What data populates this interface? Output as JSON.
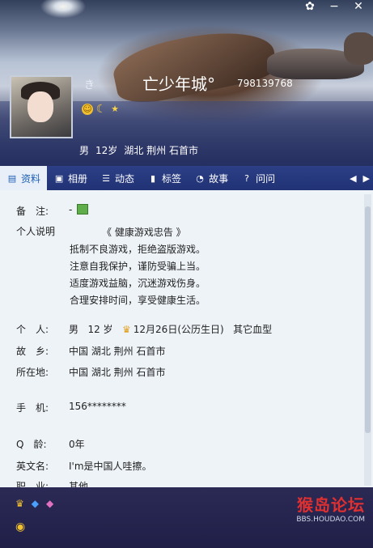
{
  "window": {
    "buttons": [
      "skin-icon",
      "minimize-icon",
      "close-icon"
    ],
    "minimize": "−",
    "close": "✕",
    "skin": "✿"
  },
  "profile": {
    "small_symbol": "き",
    "nickname": "亡少年城°",
    "qq": "798139768",
    "gender": "男",
    "age": "12岁",
    "province": "湖北",
    "city": "荆州",
    "district": "石首市"
  },
  "tabs": [
    {
      "label": "资料",
      "icon": "profile-icon"
    },
    {
      "label": "相册",
      "icon": "album-icon"
    },
    {
      "label": "动态",
      "icon": "feed-icon"
    },
    {
      "label": "标签",
      "icon": "tag-icon"
    },
    {
      "label": "故事",
      "icon": "story-icon"
    },
    {
      "label": "问问",
      "icon": "ask-icon"
    }
  ],
  "details": {
    "remark_label": "备　注:",
    "remark_value": "-",
    "intro_label": "个人说明",
    "intro_lines": [
      "《 健康游戏忠告 》",
      "抵制不良游戏，拒绝盗版游戏。",
      "注意自我保护，谨防受骗上当。",
      "适度游戏益脑，沉迷游戏伤身。",
      "合理安排时间，享受健康生活。"
    ],
    "personal_label": "个　人:",
    "personal_gender": "男",
    "personal_age": "12 岁",
    "personal_birthday": "12月26日(公历生日)",
    "personal_blood": "其它血型",
    "hometown_label": "故　乡:",
    "hometown_value": "中国 湖北 荆州 石首市",
    "location_label": "所在地:",
    "location_value": "中国 湖北 荆州 石首市",
    "phone_label": "手　机:",
    "phone_value": "156********",
    "qage_label": "Q　龄:",
    "qage_value": "0年",
    "english_label": "英文名:",
    "english_value": "I'm是中国人哇擦。",
    "job_label": "职　业:",
    "job_value": "其他"
  },
  "watermark": {
    "title": "猴岛论坛",
    "url": "BBS.HOUDAO.COM"
  }
}
